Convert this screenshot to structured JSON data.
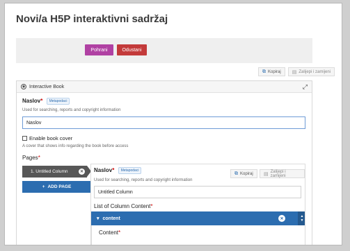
{
  "page": {
    "title": "Novi/a H5P interaktivni sadržaj"
  },
  "actions": {
    "save": "Pohrani",
    "cancel": "Odustani"
  },
  "toolbar": {
    "copy": "Kopiraj",
    "paste": "Zalijepi i zamijeni"
  },
  "editor": {
    "header": "Interactive Book",
    "title_field": {
      "label": "Naslov",
      "required": "*",
      "meta_badge": "Metapodaci",
      "description": "Used for searching, reports and copyright information",
      "value": "Naslov"
    },
    "cover": {
      "label": "Enable book cover",
      "description": "A cover that shows info regarding the book before access"
    },
    "pages": {
      "label": "Pages",
      "required": "*",
      "chapter": "1. Untitled Column",
      "add_page": "ADD PAGE"
    },
    "chapter_panel": {
      "title_label": "Naslov",
      "required": "*",
      "meta_badge": "Metapodaci",
      "copy": "Kopiraj",
      "paste": "Zalijepi i zamijeni",
      "description": "Used for searching, reports and copyright information",
      "value": "Untitled Column",
      "list_label": "List of Column Content",
      "list_required": "*",
      "group_label": "content",
      "content_label": "Content",
      "content_required": "*"
    }
  },
  "colors": {
    "save": "#b041a3",
    "cancel": "#c33a3a",
    "accent": "#2c6db0",
    "chapter_bg": "#575757"
  },
  "icons": {
    "copy": "copy-icon",
    "paste": "paste-icon",
    "expand": "expand-icon",
    "remove": "close-icon",
    "add": "plus-icon",
    "collapse": "chevron-down-icon"
  }
}
